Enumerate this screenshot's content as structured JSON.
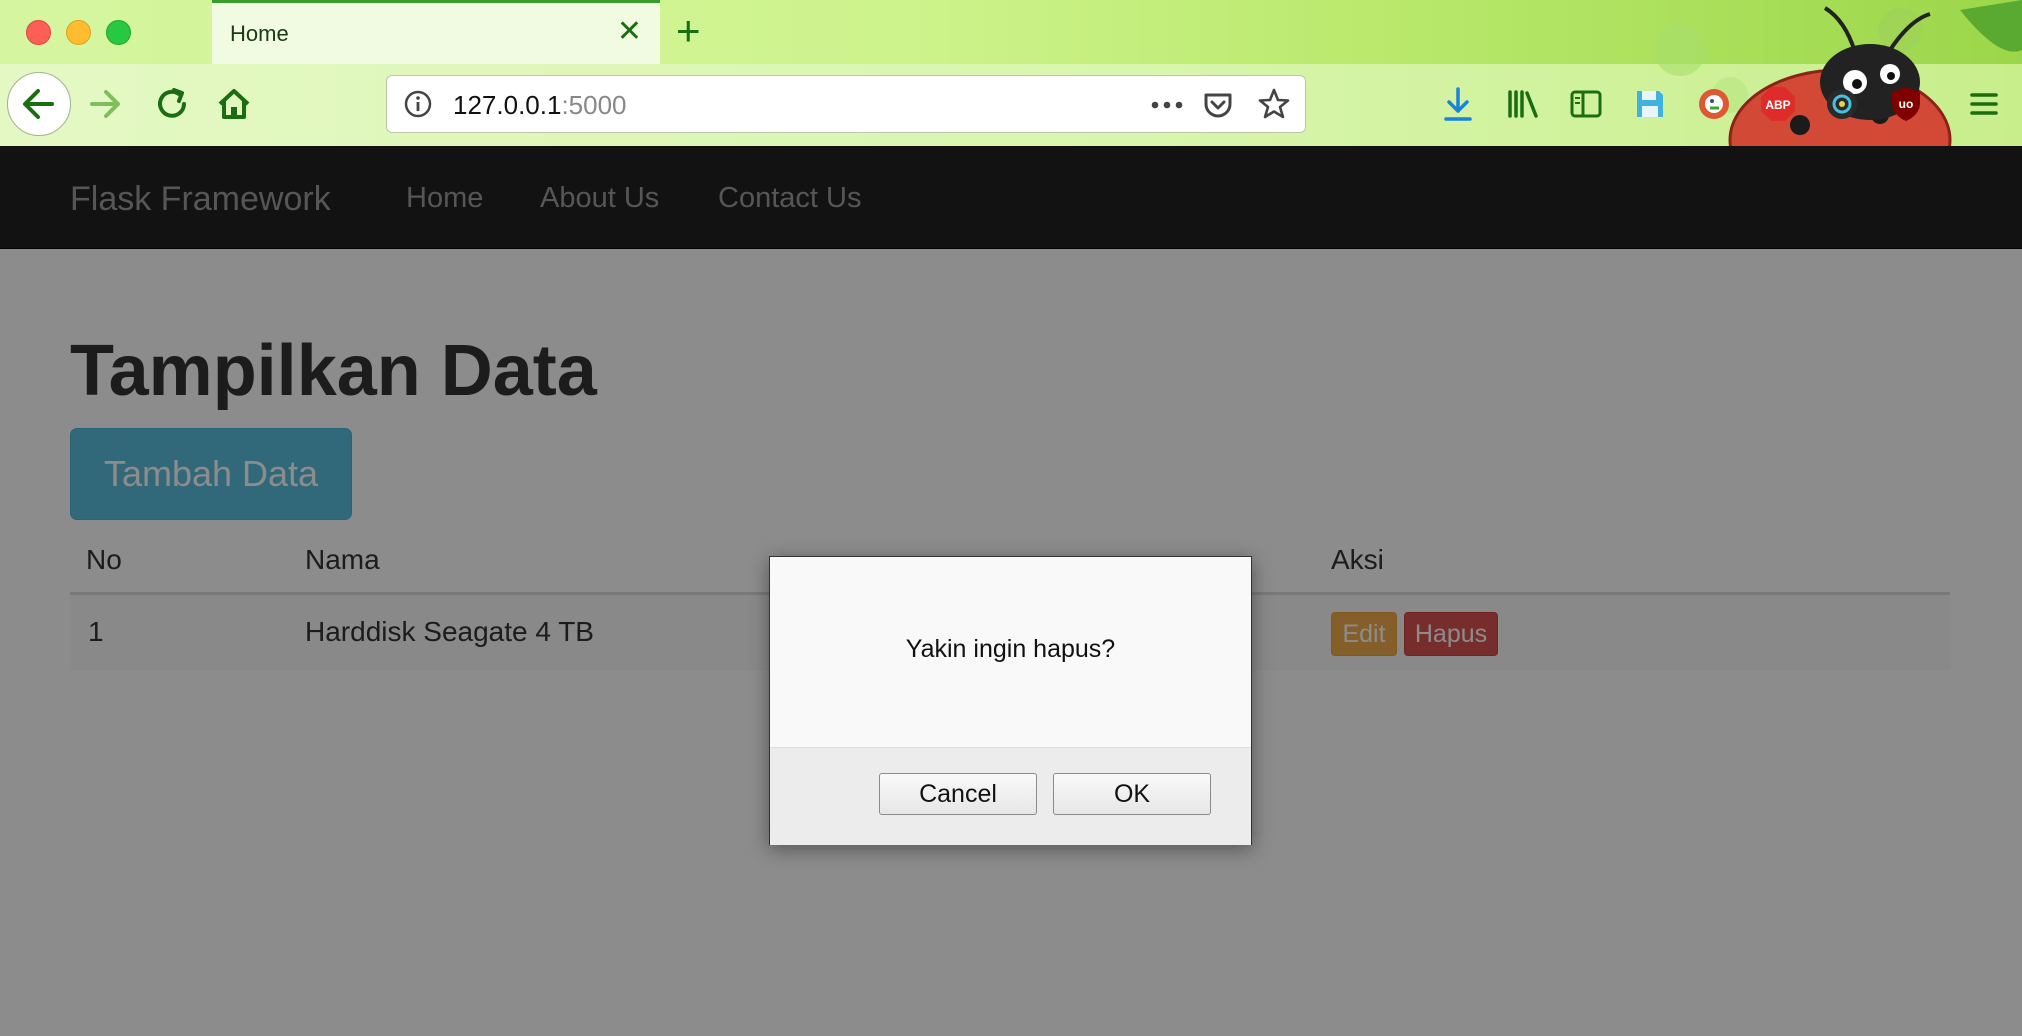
{
  "browser": {
    "tab_title": "Home",
    "url_host": "127.0.0.1",
    "url_port": ":5000"
  },
  "site": {
    "brand": "Flask Framework",
    "nav": [
      "Home",
      "About Us",
      "Contact Us"
    ]
  },
  "main": {
    "title": "Tampilkan Data",
    "add_button": "Tambah Data",
    "table": {
      "headers": [
        "No",
        "Nama",
        "Aksi"
      ],
      "rows": [
        {
          "no": "1",
          "nama": "Harddisk Seagate 4 TB",
          "edit": "Edit",
          "hapus": "Hapus"
        }
      ]
    }
  },
  "dialog": {
    "message": "Yakin ingin hapus?",
    "cancel": "Cancel",
    "ok": "OK"
  },
  "icons": {
    "back": "back-arrow-icon",
    "forward": "forward-arrow-icon",
    "reload": "reload-icon",
    "home": "home-icon",
    "info": "info-icon",
    "more": "more-icon",
    "pocket": "pocket-icon",
    "bookmark": "star-icon",
    "download": "download-icon",
    "library": "library-icon",
    "sidebar": "sidebar-icon",
    "save": "save-icon",
    "duckduckgo": "duckduckgo-icon",
    "adblock": "adblock-icon",
    "camera": "camera-icon",
    "ublock": "ublock-icon",
    "menu": "hamburger-menu-icon"
  },
  "colors": {
    "navbar": "#222222",
    "info_button": "#5bc0de",
    "warning_button": "#f0ad4e",
    "danger_button": "#d9534f"
  }
}
